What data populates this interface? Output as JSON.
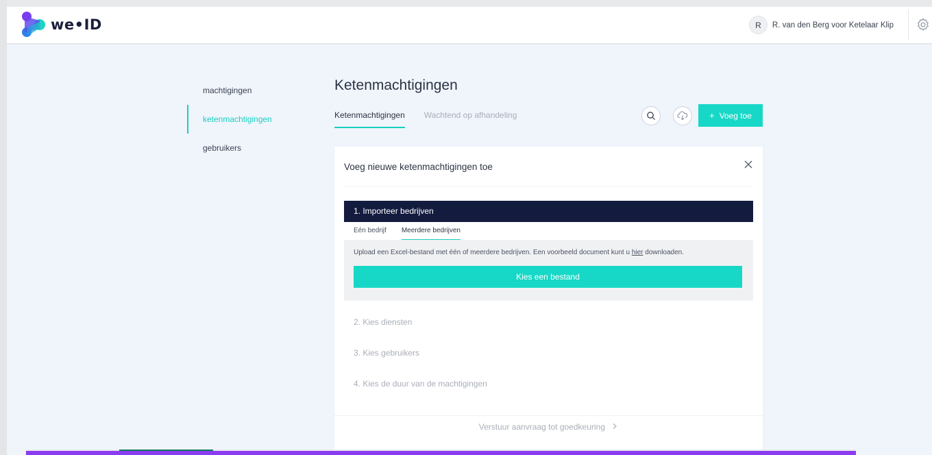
{
  "app": {
    "brand": "we•ID",
    "user_initial": "R",
    "user_name": "R. van den Berg voor Ketelaar Klip"
  },
  "sidebar": {
    "items": [
      {
        "label": "machtigingen",
        "active": false
      },
      {
        "label": "ketenmachtigingen",
        "active": true
      },
      {
        "label": "gebruikers",
        "active": false
      }
    ]
  },
  "page": {
    "title": "Ketenmachtigingen",
    "tabs": [
      {
        "label": "Ketenmachtigingen",
        "active": true
      },
      {
        "label": "Wachtend op afhandeling",
        "active": false
      }
    ],
    "add_button": "Voeg toe",
    "icons": [
      "search-icon",
      "cloud-download-icon",
      "plus-icon",
      "gear-icon",
      "close-icon",
      "chevron-right-icon"
    ]
  },
  "dialog": {
    "title": "Voeg nieuwe ketenmachtigingen toe",
    "step1": {
      "title": "1. Importeer bedrijven",
      "subtabs": [
        {
          "label": "Eén bedrijf",
          "active": false
        },
        {
          "label": "Meerdere bedrijven",
          "active": true
        }
      ],
      "upload_text_before": "Upload een Excel-bestand met één of meerdere bedrijven. Een voorbeeld document kunt u",
      "upload_link": "hier",
      "upload_text_after": "downloaden.",
      "choose_button": "Kies een bestand"
    },
    "step2": "2. Kies diensten",
    "step3": "3. Kies gebruikers",
    "step4": "4. Kies de duur van de machtigingen",
    "submit": "Verstuur aanvraag tot goedkeuring"
  },
  "colors": {
    "accent": "#17d8c6",
    "dark_navy": "#131b3f",
    "page_bg": "#f0f5fc",
    "bottom_bar": "#8a3cf0"
  }
}
